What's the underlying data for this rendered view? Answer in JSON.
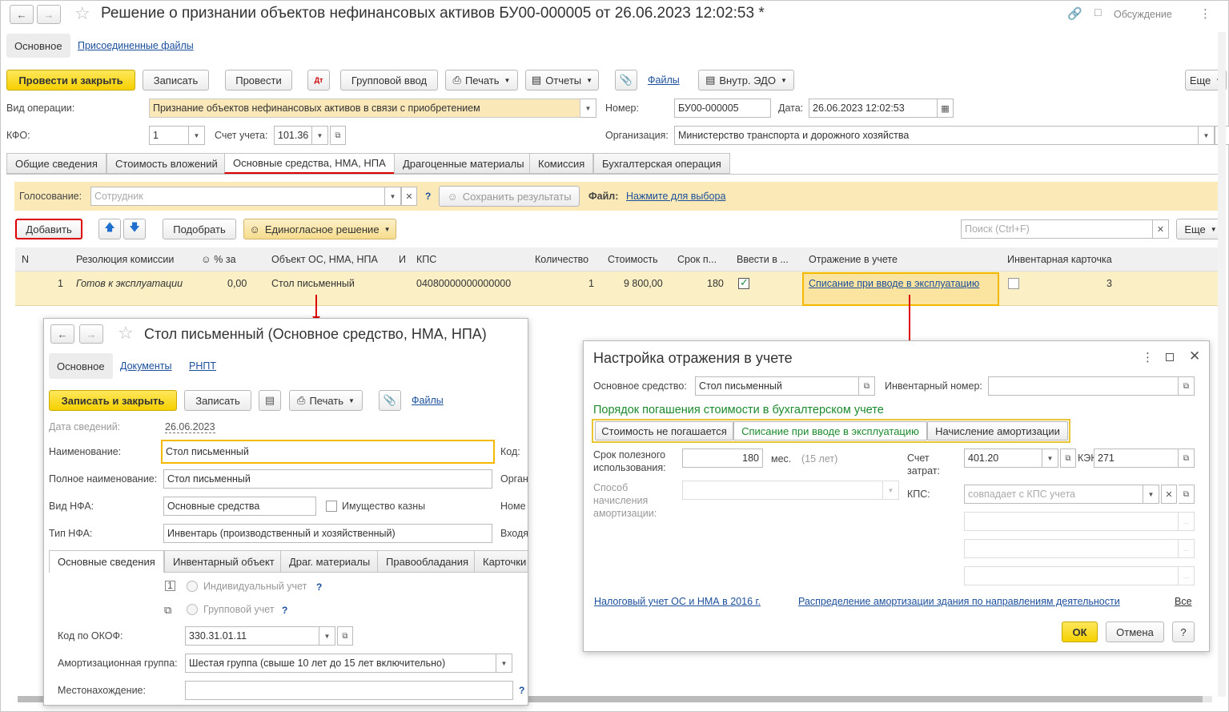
{
  "main": {
    "title": "Решение о признании объектов нефинансовых активов БУ00-000005 от 26.06.2023 12:02:53 *",
    "discussion": "Обсуждение",
    "nav_main": "Основное",
    "nav_files": "Присоединенные файлы",
    "toolbar": {
      "post_close": "Провести и закрыть",
      "save": "Записать",
      "post": "Провести",
      "group_input": "Групповой ввод",
      "print": "Печать",
      "reports": "Отчеты",
      "files": "Файлы",
      "edo": "Внутр. ЭДО",
      "more": "Еще"
    },
    "operation_label": "Вид операции:",
    "operation_value": "Признание объектов нефинансовых активов в связи с приобретением",
    "number_label": "Номер:",
    "number_value": "БУ00-000005",
    "date_label": "Дата:",
    "date_value": "26.06.2023 12:02:53",
    "kfo_label": "КФО:",
    "kfo_value": "1",
    "account_label": "Счет учета:",
    "account_value": "101.36",
    "org_label": "Организация:",
    "org_value": "Министерство транспорта и дорожного хозяйства",
    "tabs": [
      "Общие сведения",
      "Стоимость вложений",
      "Основные средства, НМА, НПА",
      "Драгоценные материалы",
      "Комиссия",
      "Бухгалтерская операция"
    ],
    "voting_label": "Голосование:",
    "voting_placeholder": "Сотрудник",
    "save_results": "Сохранить результаты",
    "file_label": "Файл:",
    "file_link": "Нажмите для выбора",
    "add": "Добавить",
    "pick": "Подобрать",
    "unanimous": "Единогласное решение",
    "search_placeholder": "Поиск (Ctrl+F)",
    "more2": "Еще",
    "columns": [
      "N",
      "Резолюция комиссии",
      "% за",
      "Объект ОС, НМА, НПА",
      "И",
      "КПС",
      "Количество",
      "Стоимость",
      "Срок п...",
      "Ввести в ...",
      "Отражение в учете",
      "Инвентарная карточка"
    ],
    "row": {
      "n": "1",
      "resolution": "Готов к эксплуатации",
      "percent": "0,00",
      "object": "Стол письменный",
      "kps": "04080000000000000",
      "qty": "1",
      "cost": "9 800,00",
      "term": "180",
      "reflection": "Списание при вводе в эксплуатацию",
      "card": "3"
    }
  },
  "asset_window": {
    "title": "Стол письменный (Основное средство, НМА, НПА)",
    "nav": [
      "Основное",
      "Документы",
      "РНПТ"
    ],
    "save_close": "Записать и закрыть",
    "save": "Записать",
    "print": "Печать",
    "files": "Файлы",
    "date_label": "Дата сведений:",
    "date_value": "26.06.2023",
    "name_label": "Наименование:",
    "name_value": "Стол письменный",
    "code_label": "Код:",
    "fullname_label": "Полное наименование:",
    "fullname_value": "Стол письменный",
    "organ_label": "Орган",
    "nfa_type_label": "Вид НФА:",
    "nfa_type_value": "Основные средства",
    "treasury": "Имущество казны",
    "nomer_label": "Номе",
    "nfa_kind_label": "Тип НФА:",
    "nfa_kind_value": "Инвентарь (производственный и хозяйственный)",
    "vhod_label": "Входя",
    "tabs": [
      "Основные сведения",
      "Инвентарный объект",
      "Драг. материалы",
      "Правообладания",
      "Карточки"
    ],
    "individual": "Индивидуальный учет",
    "group": "Групповой учет",
    "okof_label": "Код по ОКОФ:",
    "okof_value": "330.31.01.11",
    "amort_label": "Амортизационная группа:",
    "amort_value": "Шестая группа (свыше 10 лет до 15 лет включительно)",
    "location_label": "Местонахождение:"
  },
  "setting_window": {
    "title": "Настройка отражения в учете",
    "asset_label": "Основное средство:",
    "asset_value": "Стол письменный",
    "inv_label": "Инвентарный номер:",
    "section": "Порядок погашения стоимости в бухгалтерском учете",
    "options": [
      "Стоимость не погашается",
      "Списание при вводе в эксплуатацию",
      "Начисление амортизации"
    ],
    "life_label_1": "Срок полезного",
    "life_label_2": "использования:",
    "life_value": "180",
    "life_unit": "мес.",
    "life_years": "(15 лет)",
    "cost_acc_label_1": "Счет",
    "cost_acc_label_2": "затрат:",
    "cost_acc_value": "401.20",
    "kek_label": "КЭК:",
    "kek_value": "271",
    "method_label_1": "Способ",
    "method_label_2": "начисления",
    "method_label_3": "амортизации:",
    "kps_label": "КПС:",
    "kps_placeholder": "совпадает с КПС учета",
    "tax_link": "Налоговый учет ОС и НМА в 2016 г.",
    "dist_link": "Распределение амортизации здания по направлениям деятельности",
    "all_link": "Все",
    "ok": "ОК",
    "cancel": "Отмена",
    "help": "?"
  }
}
